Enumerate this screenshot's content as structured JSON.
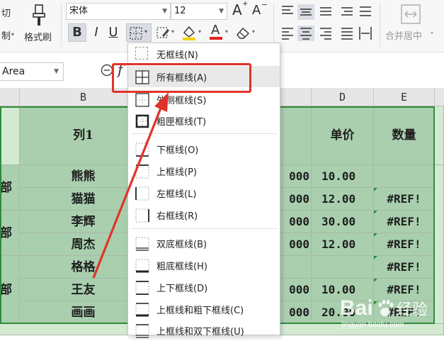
{
  "ribbon": {
    "cut_label": "切",
    "paste_label": "制",
    "format_painter_label": "格式刷",
    "font_name": "宋体",
    "font_size": "12",
    "bold": "B",
    "italic": "I",
    "underline": "U",
    "font_color_glyph": "A",
    "grow_glyph": "A",
    "shrink_glyph": "A",
    "merge_label": "合并居中"
  },
  "formula_bar": {
    "name_box": "Area",
    "fx_glyph": "f"
  },
  "columns": {
    "B": "B",
    "D": "D",
    "E": "E"
  },
  "table": {
    "header": {
      "col_b": "列1",
      "col_d": "单价",
      "col_e": "数量"
    },
    "dept_labels": [
      "部",
      "部",
      "部"
    ],
    "names": [
      "熊熊",
      "猫猫",
      "李辉",
      "周杰",
      "格格",
      "王友",
      "画画"
    ],
    "col_c_partial": [
      "000",
      "000",
      "000",
      "000",
      "",
      "000",
      "000"
    ],
    "prices": [
      "10.00",
      "12.00",
      "30.00",
      "12.00",
      "",
      "10.00",
      "20.00"
    ],
    "quantities": [
      "",
      "#REF!",
      "#REF!",
      "#REF!",
      "#REF!",
      "#REF!",
      "#REF!"
    ]
  },
  "border_menu": {
    "items": [
      {
        "label": "无框线(N)"
      },
      {
        "label": "所有框线(A)"
      },
      {
        "label": "外侧框线(S)"
      },
      {
        "label": "粗匣框线(T)"
      },
      {
        "label": "下框线(O)"
      },
      {
        "label": "上框线(P)"
      },
      {
        "label": "左框线(L)"
      },
      {
        "label": "右框线(R)"
      },
      {
        "label": "双底框线(B)"
      },
      {
        "label": "粗底框线(H)"
      },
      {
        "label": "上下框线(D)"
      },
      {
        "label": "上框线和粗下框线(C)"
      },
      {
        "label": "上框线和双下框线(U)"
      }
    ]
  },
  "watermark": {
    "text": "Bai du 经验",
    "url": "jingyan.baidu.com"
  },
  "colors": {
    "cell_green": "#a9cfae",
    "cell_pale": "#d3e9d2",
    "highlight_red": "#e2332a",
    "selection_border": "#2e8b3c"
  }
}
